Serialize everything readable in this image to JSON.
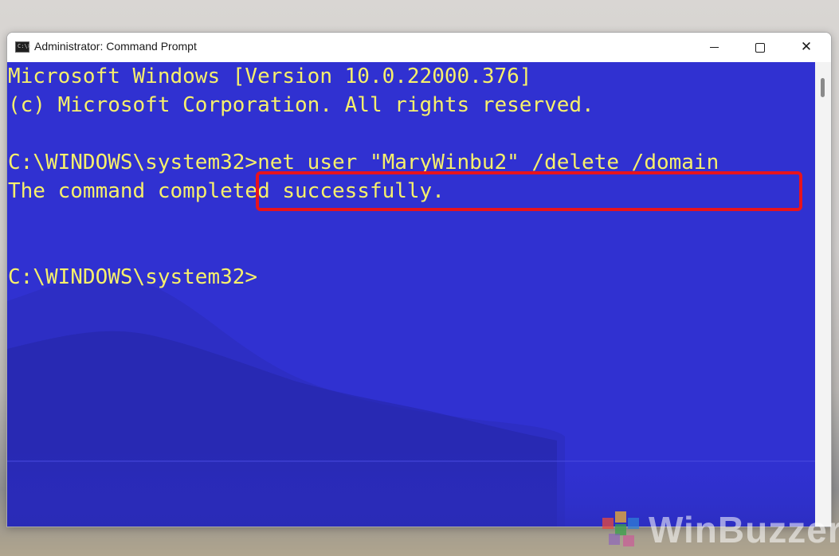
{
  "window": {
    "title": "Administrator: Command Prompt",
    "icon": "command-prompt-icon",
    "controls": {
      "minimize_icon": "minimize-icon",
      "maximize_icon": "maximize-icon",
      "close_glyph": "✕"
    }
  },
  "console": {
    "background_color": "#3031d1",
    "text_color": "#f7f06b",
    "lines": [
      "Microsoft Windows [Version 10.0.22000.376]",
      "(c) Microsoft Corporation. All rights reserved.",
      "C:\\WINDOWS\\system32>net user \"MaryWinbu2\" /delete /domain",
      "The command completed successfully.",
      "C:\\WINDOWS\\system32>"
    ],
    "highlight_color": "#e8131d"
  },
  "icon_prompt_glyph": "C:\\>",
  "watermark": {
    "text": "WinBuzzer"
  }
}
